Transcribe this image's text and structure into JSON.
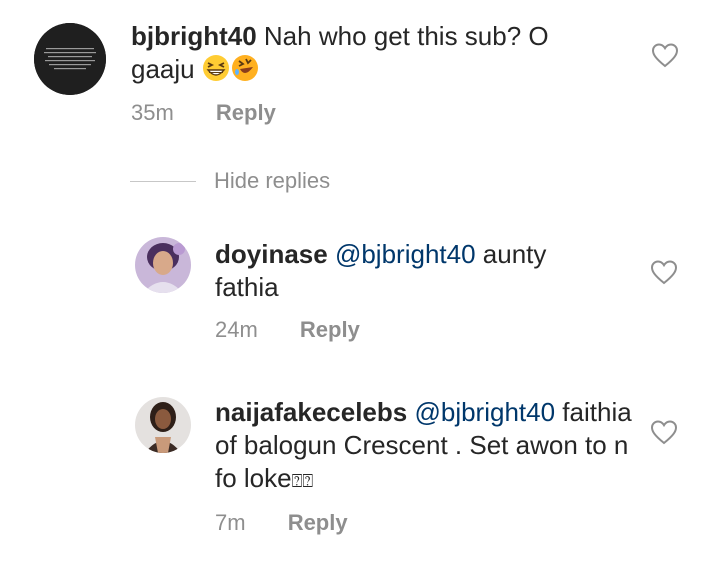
{
  "comments": [
    {
      "username": "bjbright40",
      "text": "Nah who get this sub? O gaaju",
      "time": "35m",
      "reply_label": "Reply",
      "emojis": [
        "grinning-squinting-face",
        "rolling-on-floor-laughing"
      ],
      "avatar": "dark-quote-image-avatar"
    }
  ],
  "replies_toggle": {
    "label": "Hide replies"
  },
  "replies": [
    {
      "username": "doyinase",
      "mention": "@bjbright40",
      "text": "aunty fathia",
      "time": "24m",
      "reply_label": "Reply",
      "avatar": "purple-portrait-avatar"
    },
    {
      "username": "naijafakecelebs",
      "mention": "@bjbright40",
      "text": "faithia of balogun Crescent . Set awon to n fo loke",
      "trailing_glyphs": "⍰⍰",
      "time": "7m",
      "reply_label": "Reply",
      "avatar": "woman-portrait-avatar"
    }
  ],
  "icons": {
    "like": "heart-outline-icon"
  },
  "colors": {
    "text": "#262626",
    "secondary": "#8e8e8e",
    "mention": "#00376b",
    "divider": "#c7c7c7"
  }
}
